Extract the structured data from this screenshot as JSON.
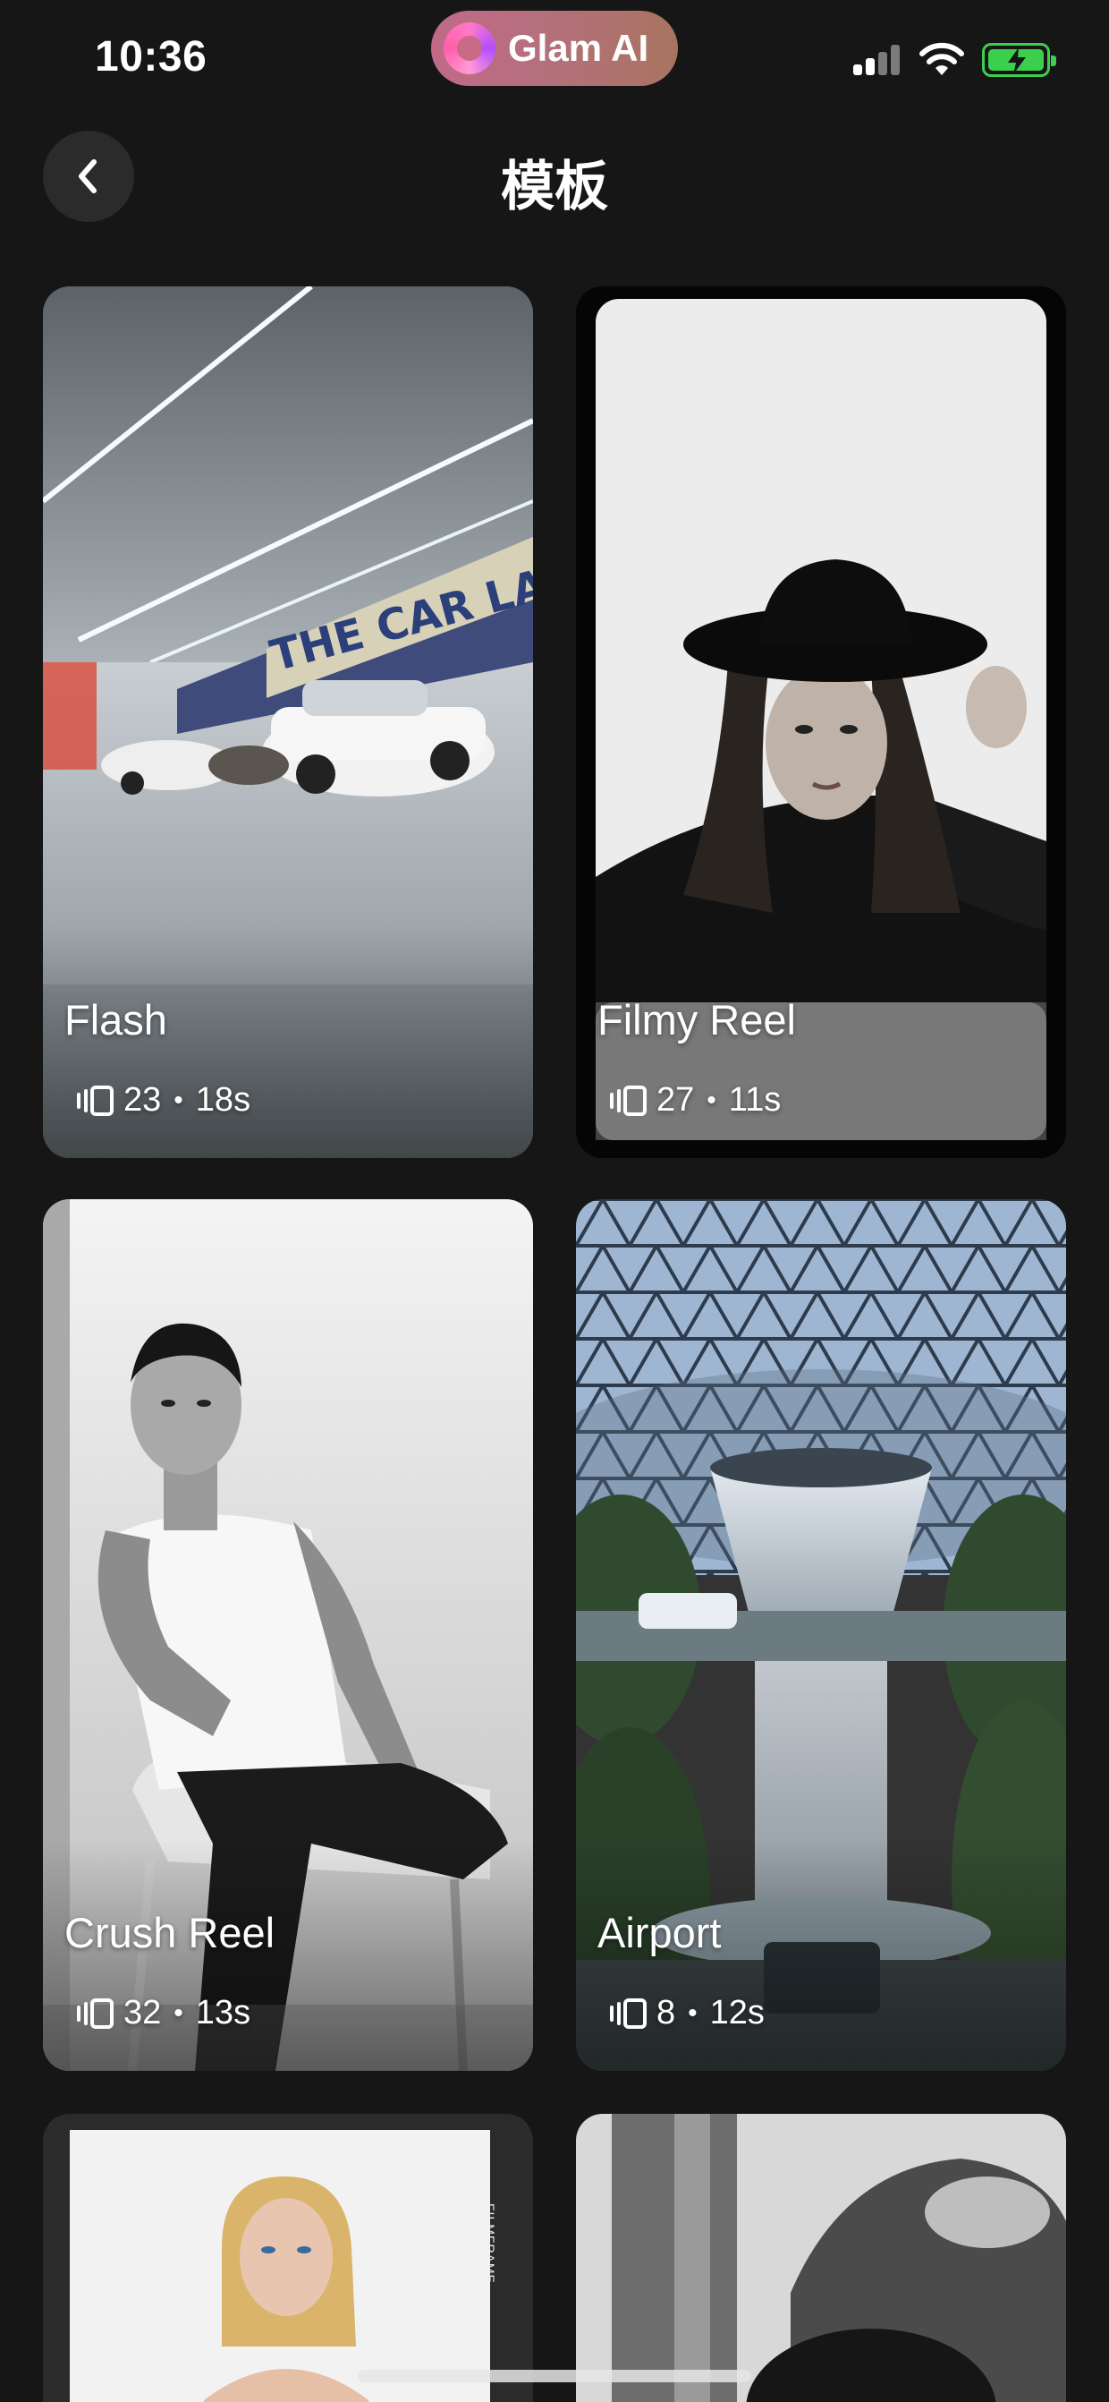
{
  "status_bar": {
    "time": "10:36",
    "app_name": "Glam AI",
    "icons": [
      "cellular-signal-icon",
      "wifi-icon",
      "battery-charging-icon"
    ],
    "battery_color": "#3ccf4e"
  },
  "header": {
    "back_icon": "chevron-left-icon",
    "title": "模板"
  },
  "templates": [
    {
      "name": "Flash",
      "clips": "23",
      "duration": "18s"
    },
    {
      "name": "Filmy Reel",
      "clips": "27",
      "duration": "11s"
    },
    {
      "name": "Crush Reel",
      "clips": "32",
      "duration": "13s"
    },
    {
      "name": "Airport",
      "clips": "8",
      "duration": "12s"
    }
  ],
  "meta_separator": "•",
  "partial_row": {
    "left_card_frame_text": "FILMFRAME"
  },
  "colors": {
    "background": "#161616",
    "card": "#2a2a2a",
    "island_gradient_start": "#c06a88",
    "island_gradient_end": "#a8745f"
  }
}
